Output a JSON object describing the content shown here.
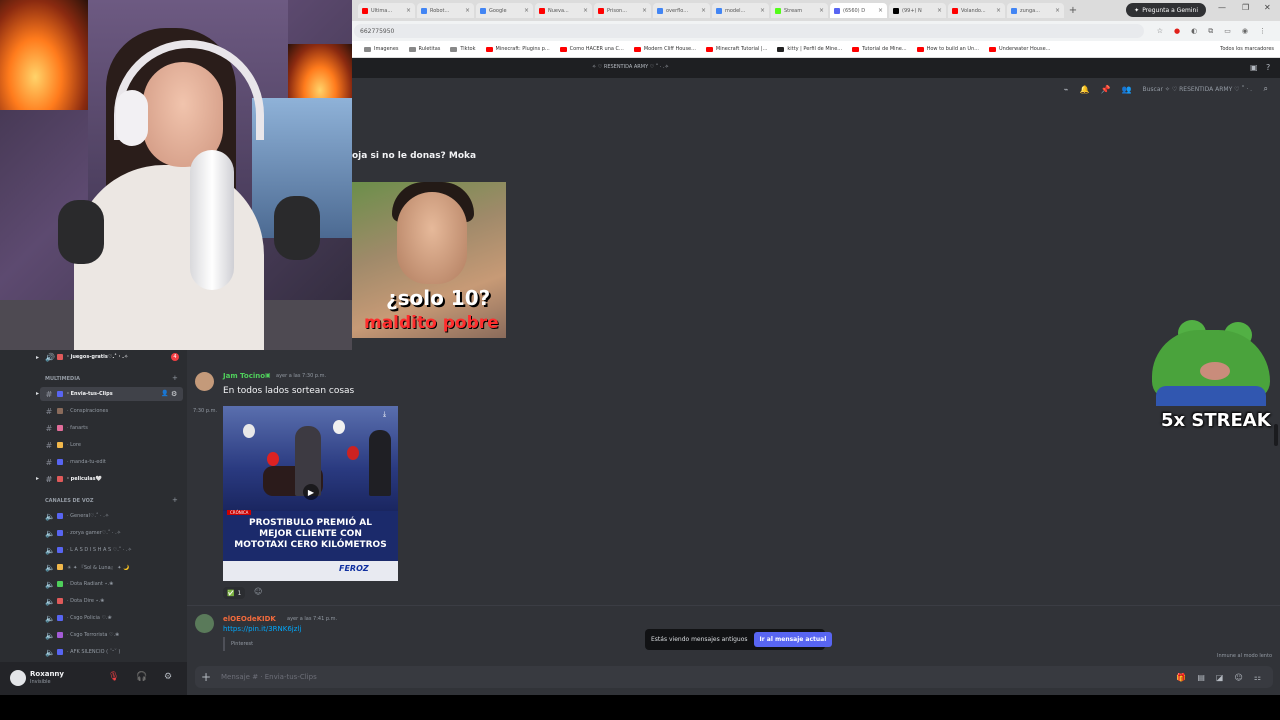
{
  "browser": {
    "tabs": [
      {
        "label": "Ultima...",
        "color": "#ff0000"
      },
      {
        "label": "Robot...",
        "color": "#4285f4"
      },
      {
        "label": "Google",
        "color": "#4285f4"
      },
      {
        "label": "Nueva...",
        "color": "#ff0000"
      },
      {
        "label": "Prison...",
        "color": "#ff0000"
      },
      {
        "label": "overflo...",
        "color": "#4285f4"
      },
      {
        "label": "model...",
        "color": "#4285f4"
      },
      {
        "label": "Stream",
        "color": "#53fc18"
      },
      {
        "label": "(6560) D",
        "color": "#5865f2",
        "active": true
      },
      {
        "label": "(99+) N",
        "color": "#000000"
      },
      {
        "label": "Volando...",
        "color": "#ff0000"
      },
      {
        "label": "zunga...",
        "color": "#4285f4"
      }
    ],
    "gemini_label": "Pregunta a Gemini",
    "url": "662775950",
    "bookmarks": [
      {
        "label": "Imagenes",
        "color": "#888888"
      },
      {
        "label": "Ruletitas",
        "color": "#888888"
      },
      {
        "label": "Tiktok",
        "color": "#888888"
      },
      {
        "label": "Minecraft: Plugins p...",
        "color": "#ff0000"
      },
      {
        "label": "Como HACER una C...",
        "color": "#ff0000"
      },
      {
        "label": "Modern Cliff House...",
        "color": "#ff0000"
      },
      {
        "label": "Minecraft Tutorial |...",
        "color": "#ff0000"
      },
      {
        "label": "kitty | Perfil de Mine...",
        "color": "#222222"
      },
      {
        "label": "Tutorial de Mine...",
        "color": "#ff0000"
      },
      {
        "label": "How to build an Un...",
        "color": "#ff0000"
      },
      {
        "label": "Underwater House...",
        "color": "#ff0000"
      }
    ],
    "all_bookmarks": "Todos los marcadores"
  },
  "discord": {
    "server_title": "✧ ♡ RESENTIDA ARMY ♡ ˚ · .✧",
    "search_placeholder": "Buscar ✧ ♡ RESENTIDA ARMY ♡ ˚ · .",
    "old_message_text": "oja si no le donas? Moka",
    "thumb1": {
      "line1": "¿solo 10?",
      "line2": "maldito pobre"
    },
    "messages": [
      {
        "user": "Jam Tocino",
        "user_color": "#4fcf5b",
        "timestamp": "ayer a las 7:30 p.m.",
        "side_time": "7:30 p.m.",
        "text": "En todos lados sortean cosas",
        "clip": {
          "tag": "CRÓNICA",
          "headline": "PROSTIBULO PREMIÓ AL\nMEJOR CLIENTE CON\nMOTOTAXI CERO KILÓMETROS",
          "brand": "FEROZ"
        },
        "reaction": {
          "emoji": "✅",
          "count": "1"
        }
      },
      {
        "user": "elOEOdeKIDK",
        "user_color": "#f26a3c",
        "timestamp": "ayer a las 7:41 p.m.",
        "link": "https://pin.it/3RNK6jzlj",
        "embed": "Pinterest"
      }
    ],
    "old_banner": {
      "text": "Estás viendo mensajes antiguos",
      "button": "Ir al mensaje actual"
    },
    "slowmode": "Inmune al modo lento",
    "composer_placeholder": "Mensaje #   ·  Envia-tus-Clips",
    "sidebar": {
      "channels_top": [
        {
          "label": "· juegos-gratis♡.˚ · .✧",
          "bold": true,
          "color": "#e05a5a",
          "badge": "4"
        }
      ],
      "category_multimedia": "MULTIMEDIA",
      "multimedia_channels": [
        {
          "label": "· Envia-tus-Clips",
          "bold": true,
          "color": "#5865f2"
        },
        {
          "label": "· Conspiraciones",
          "bold": false,
          "color": "#8a6b5b"
        },
        {
          "label": "· fanarts",
          "bold": false,
          "color": "#e26d9a"
        },
        {
          "label": "· Lore",
          "bold": false,
          "color": "#f2b84b"
        },
        {
          "label": "· manda-tu-edit",
          "bold": false,
          "color": "#5865f2"
        },
        {
          "label": "· peliculas🤍",
          "bold": true,
          "color": "#e05a5a"
        }
      ],
      "category_voice": "CANALES DE VOZ",
      "voice_channels": [
        {
          "label": "· General♡.˚ · .✧",
          "color": "#5865f2"
        },
        {
          "label": "· zorya gamer♡.˚ · .✧",
          "color": "#5865f2"
        },
        {
          "label": "· L A S D I S H A S ♡.˚ · .✧",
          "color": "#5865f2"
        },
        {
          "label": "☀ ✦ 『Sol & Luna』 ✦ 🌙",
          "color": "#f2b84b"
        },
        {
          "label": "· Dota Radiant ⋆.❀",
          "color": "#4fcf5b"
        },
        {
          "label": "· Dota Dire ⋆.❀",
          "color": "#e05a5a"
        },
        {
          "label": "· Csgo Policia ♡.❀",
          "color": "#5865f2"
        },
        {
          "label": "· Csgo Terrorista ♡.❀",
          "color": "#a45bd6"
        },
        {
          "label": "· AFK SILENCIO ( ˘ᵕ˘ )",
          "color": "#5865f2"
        }
      ]
    },
    "user_panel": {
      "name": "Roxanny",
      "status": "Invisible"
    }
  },
  "overlay": {
    "streak": "5x STREAK"
  }
}
